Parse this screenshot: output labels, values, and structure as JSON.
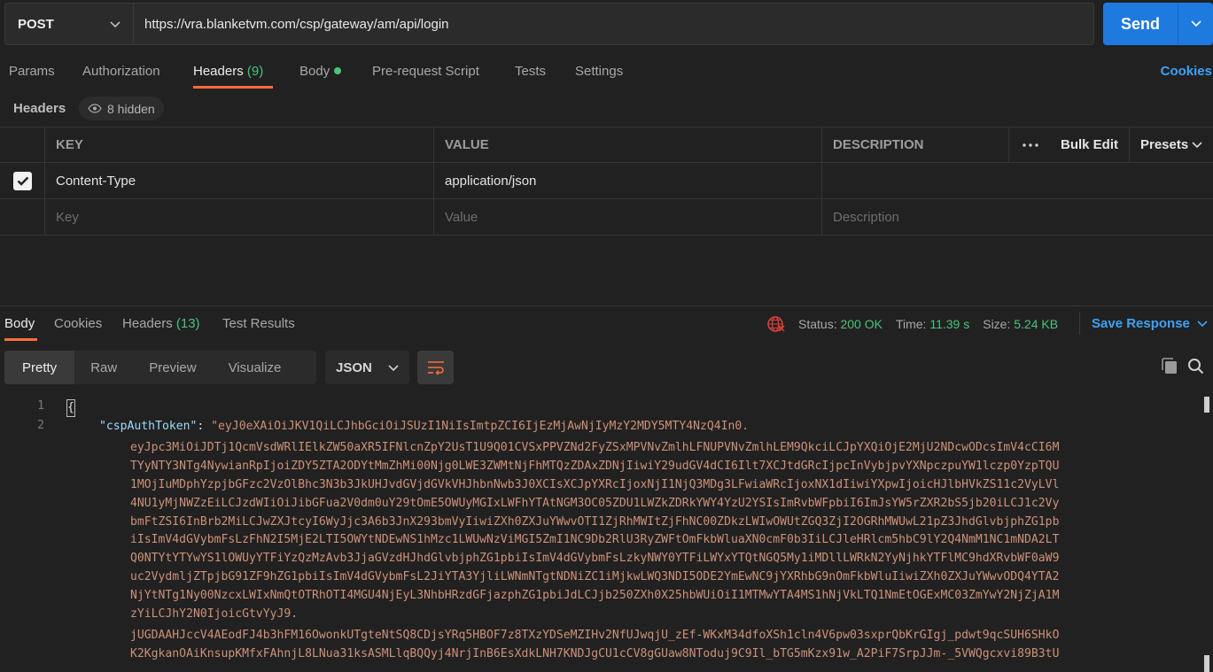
{
  "request": {
    "method": "POST",
    "url": "https://vra.blanketvm.com/csp/gateway/am/api/login",
    "send_label": "Send"
  },
  "req_tabs": {
    "params": "Params",
    "authorization": "Authorization",
    "headers": "Headers",
    "headers_count": "(9)",
    "body": "Body",
    "prerequest": "Pre-request Script",
    "tests": "Tests",
    "settings": "Settings",
    "cookies": "Cookies"
  },
  "headers_section": {
    "title": "Headers",
    "hidden_label": "8 hidden",
    "columns": {
      "key": "KEY",
      "value": "VALUE",
      "description": "DESCRIPTION",
      "bulk_edit": "Bulk Edit",
      "presets": "Presets"
    },
    "rows": [
      {
        "checked": true,
        "key": "Content-Type",
        "value": "application/json",
        "description": ""
      }
    ],
    "placeholders": {
      "key": "Key",
      "value": "Value",
      "description": "Description"
    }
  },
  "response": {
    "tabs": {
      "body": "Body",
      "cookies": "Cookies",
      "headers": "Headers",
      "headers_count": "(13)",
      "test_results": "Test Results"
    },
    "status_label": "Status:",
    "status_value": "200 OK",
    "time_label": "Time:",
    "time_value": "11.39 s",
    "size_label": "Size:",
    "size_value": "5.24 KB",
    "save_response": "Save Response",
    "views": {
      "pretty": "Pretty",
      "raw": "Raw",
      "preview": "Preview",
      "visualize": "Visualize"
    },
    "format": "JSON"
  },
  "code": {
    "line_numbers": [
      "1",
      "2"
    ],
    "brace": "{",
    "key": "\"cspAuthToken\"",
    "colon": ": ",
    "first_value": "\"eyJ0eXAiOiJKV1QiLCJhbGciOiJSUzI1NiIsImtpZCI6IjEzMjAwNjIyMzY2MDY5MTY4NzQ4In0.",
    "token_lines": [
      "eyJpc3MiOiJDTj1QcmVsdWRlIElkZW50aXR5IFNlcnZpY2UsT1U9Q01CVSxPPVZNd2FyZSxMPVNvZmlhLFNUPVNvZmlhLEM9QkciLCJpYXQiOjE2MjU2NDcwODcsImV4cCI6M",
      "TYyNTY3NTg4NywianRpIjoiZDY5ZTA2ODYtMmZhMi00Njg0LWE3ZWMtNjFhMTQzZDAxZDNjIiwiY29udGV4dCI6Ilt7XCJtdGRcIjpcInVybjpvYXNpczpuYW1lczp0YzpTQU",
      "1MOjIuMDphYzpjbGFzc2VzOlBhc3N3b3JkUHJvdGVjdGVkVHJhbnNwb3J0XCIsXCJpYXRcIjoxNjI1NjQ3MDg3LFwiaWRcIjoxNX1dIiwiYXpwIjoicHJlbHVkZS11c2VyLVl",
      "4NU1yMjNWZzEiLCJzdWIiOiJibGFua2V0dm0uY29tOmE5OWUyMGIxLWFhYTAtNGM3OC05ZDU1LWZkZDRkYWY4YzU2YSIsImRvbWFpbiI6ImJsYW5rZXR2bS5jb20iLCJ1c2Vy",
      "bmFtZSI6InBrb2MiLCJwZXJtcyI6WyJjc3A6b3JnX293bmVyIiwiZXh0ZXJuYWwvOTI1ZjRhMWItZjFhNC00ZDkzLWIwOWUtZGQ3ZjI2OGRhMWUwL21pZ3JhdGlvbjphZG1pb",
      "iIsImV4dGVybmFsLzFhN2I5MjE2LTI5OWYtNDEwNS1hMzc1LWUwNzViMGI5ZmI1NC9Db2RlU3RyZWFtOmFkbWluaXN0cmF0b3IiLCJleHRlcm5hbC9lY2Q4NmM1NC1mNDA2LT",
      "Q0NTYtYTYwYS1lOWUyYTFiYzQzMzAvb3JjaGVzdHJhdGlvbjphZG1pbiIsImV4dGVybmFsLzkyNWY0YTFiLWYxYTQtNGQ5My1iMDllLWRkN2YyNjhkYTFlMC9hdXRvbWF0aW9",
      "uc2VydmljZTpjbG91ZF9hZG1pbiIsImV4dGVybmFsL2JiYTA3YjliLWNmNTgtNDNiZC1iMjkwLWQ3NDI5ODE2YmEwNC9jYXRhbG9nOmFkbWluIiwiZXh0ZXJuYWwvODQ4YTA2",
      "NjYtNTg1Ny00NzcxLWIxNmQtOTRhOTI4MGU4NjEyL3NhbHRzdGFjazphZG1pbiJdLCJjb250ZXh0X25hbWUiOiI1MTMwYTA4MS1hNjVkLTQ1NmEtOGExMC03ZmYwY2NjZjA1M",
      "zYiLCJhY2N0IjoicGtvYyJ9.",
      "jUGDAAHJccV4AEodFJ4b3hFM16OwonkUTgteNtSQ8CDjsYRq5HBOF7z8TXzYDSeMZIHv2NfUJwqjU_zEf-WKxM34dfoXSh1cln4V6pw03sxprQbKrGIgj_pdwt9qcSUH6SHkO",
      "K2KgkanOAiKnsupKMfxFAhnjL8LNua31ksASMLlqBQQyj4NrjInB6EsXdkLNH7KNDJgCU1cCV8gGUaw8NToduj9C9Il_bTG5mKzx91w_A2PiF7SrpJJm-_5VWQgcxvi89B3tU"
    ]
  }
}
